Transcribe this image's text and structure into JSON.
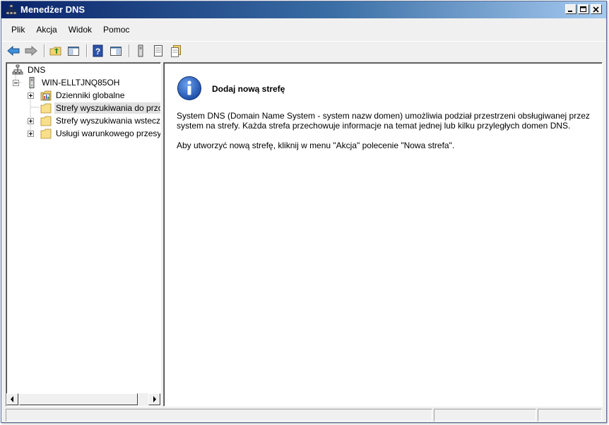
{
  "window": {
    "title": "Menedżer DNS",
    "title_color": "#ffffff",
    "titlebar_colors": [
      "#0a246a",
      "#a6caf0"
    ]
  },
  "menu": {
    "items": [
      {
        "label": "Plik"
      },
      {
        "label": "Akcja"
      },
      {
        "label": "Widok"
      },
      {
        "label": "Pomoc"
      }
    ]
  },
  "toolbar": {
    "buttons": [
      {
        "icon": "back-arrow-icon"
      },
      {
        "icon": "forward-arrow-icon"
      },
      {
        "icon": "up-folder-icon"
      },
      {
        "icon": "show-hide-console-tree-icon"
      },
      {
        "icon": "help-icon"
      },
      {
        "icon": "action-pane-icon"
      },
      {
        "icon": "server-icon"
      },
      {
        "icon": "list-view-icon"
      },
      {
        "icon": "new-zone-icon"
      }
    ]
  },
  "tree": {
    "root": "DNS",
    "server": "WIN-ELLTJNQ85OH",
    "children": [
      {
        "label": "Dzienniki globalne",
        "expander": "plus",
        "icon": "event-log-icon"
      },
      {
        "label": "Strefy wyszukiwania do przodu",
        "expander": "none",
        "icon": "folder-icon",
        "selected": true
      },
      {
        "label": "Strefy wyszukiwania wstecznego",
        "expander": "plus",
        "icon": "folder-icon"
      },
      {
        "label": "Usługi warunkowego przesyłania dalej",
        "expander": "plus",
        "icon": "folder-icon"
      }
    ]
  },
  "content": {
    "title": "Dodaj nową strefę",
    "paragraph1": "System DNS (Domain Name System - system nazw domen) umożliwia podział przestrzeni obsługiwanej przez system na strefy. Każda strefa przechowuje informacje na temat jednej lub kilku przyległych domen DNS.",
    "paragraph2": "Aby utworzyć nową strefę, kliknij w menu \"Akcja\" polecenie \"Nowa strefa\".",
    "icon": "info-icon",
    "icon_color": "#1d4fa8"
  }
}
